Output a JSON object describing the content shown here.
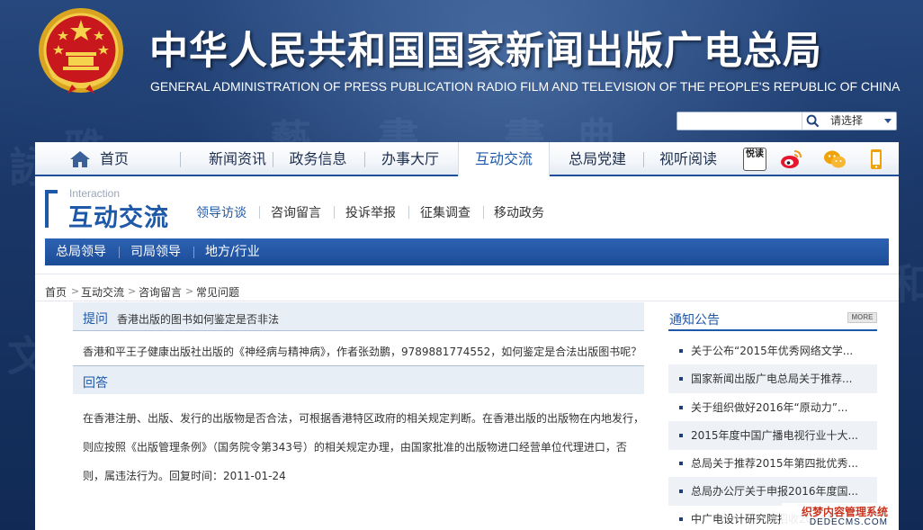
{
  "header": {
    "title": "中华人民共和国国家新闻出版广电总局",
    "subtitle": "GENERAL ADMINISTRATION OF PRESS PUBLICATION RADIO FILM AND TELEVISION OF THE PEOPLE'S REPUBLIC OF CHINA"
  },
  "search": {
    "value": "",
    "select_label": "请选择"
  },
  "mainnav": {
    "items": [
      "首页",
      "新闻资讯",
      "政务信息",
      "办事大厅",
      "互动交流",
      "总局党建",
      "视听阅读"
    ],
    "active": "互动交流",
    "social_icons": [
      "yuedu-icon",
      "weibo-icon",
      "wechat-icon",
      "mobile-icon"
    ],
    "yuedu_glyph": "悦读"
  },
  "section": {
    "english": "Interaction",
    "chinese": "互动交流",
    "subnav": [
      "领导访谈",
      "咨询留言",
      "投诉举报",
      "征集调查",
      "移动政务"
    ],
    "bluebar": [
      "总局领导",
      "司局领导",
      "地方/行业"
    ]
  },
  "breadcrumb": [
    "首页",
    "互动交流",
    "咨询留言",
    "常见问题"
  ],
  "breadcrumb_sep": ">",
  "question": {
    "label": "提问",
    "title": "香港出版的图书如何鉴定是否非法",
    "body": "香港和平王子健康出版社出版的《神经病与精神病》，作者张劲鹏，9789881774552，如何鉴定是合法出版图书呢？"
  },
  "answer": {
    "label": "回答",
    "body": "在香港注册、出版、发行的出版物是否合法，可根据香港特区政府的相关规定判断。在香港出版的出版物在内地发行，则应按照《出版管理条例》（国务院令第343号）的相关规定办理，由国家批准的出版物进口经营单位代理进口，否则，属违法行为。回复时间：2011-01-24"
  },
  "notices": {
    "title": "通知公告",
    "more": "MORE",
    "items": [
      "关于公布“2015年优秀网络文学...",
      "国家新闻出版广电总局关于推荐...",
      "关于组织做好2016年“原动力”...",
      "2015年度中国广播电视行业十大...",
      "总局关于推荐2015年第四批优秀...",
      "总局办公厅关于申报2016年度国...",
      "中广电设计研究院招收2016年..."
    ]
  },
  "watermark": {
    "cn": "织梦内容管理系统",
    "en": "DEDECMS.COM"
  },
  "colors": {
    "brand_blue": "#1e58a8",
    "nav_bar": "#1c4c97",
    "background": "#112a55"
  }
}
